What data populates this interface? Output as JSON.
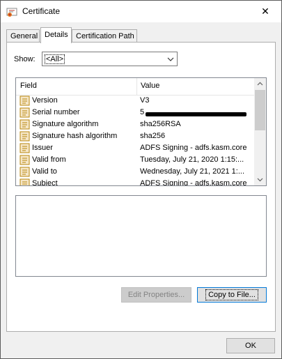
{
  "window": {
    "title": "Certificate",
    "close_glyph": "✕"
  },
  "tabs": [
    {
      "label": "General"
    },
    {
      "label": "Details"
    },
    {
      "label": "Certification Path"
    }
  ],
  "show": {
    "label": "Show:",
    "selected": "<All>"
  },
  "list": {
    "columns": [
      "Field",
      "Value"
    ],
    "rows": [
      {
        "field": "Version",
        "value": "V3"
      },
      {
        "field": "Serial number",
        "value": "5"
      },
      {
        "field": "Signature algorithm",
        "value": "sha256RSA"
      },
      {
        "field": "Signature hash algorithm",
        "value": "sha256"
      },
      {
        "field": "Issuer",
        "value": "ADFS Signing - adfs.kasm.core"
      },
      {
        "field": "Valid from",
        "value": "Tuesday, July 21, 2020 1:15:..."
      },
      {
        "field": "Valid to",
        "value": "Wednesday, July 21, 2021 1:..."
      },
      {
        "field": "Subject",
        "value": "ADFS Signing - adfs.kasm.core"
      }
    ]
  },
  "buttons": {
    "edit_properties": "Edit Properties...",
    "copy_to_file": "Copy to File...",
    "ok": "OK"
  },
  "colors": {
    "focus_border": "#0078d7",
    "icon_fill": "#f5e6c8",
    "icon_stroke": "#b8860b"
  }
}
